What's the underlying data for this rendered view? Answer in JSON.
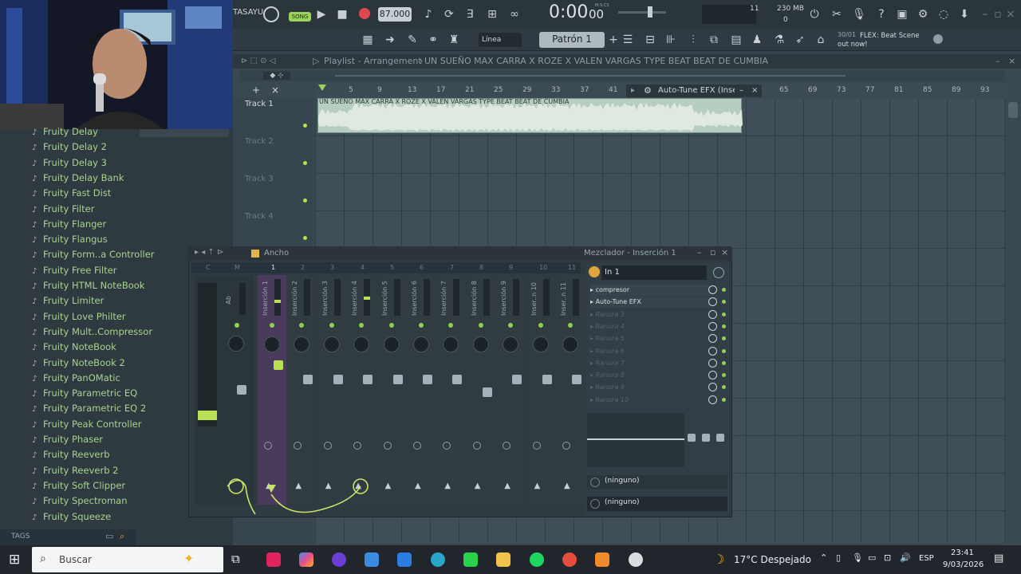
{
  "topbar": {
    "label_left": "TASAYU",
    "song_label": "SONG",
    "tempo": "87.000",
    "time_main": "0:00",
    "time_sub": "00",
    "time_unit": "M:S:CS",
    "cpu_value": "11",
    "mem_value": "230 MB",
    "mem_sub": "0"
  },
  "toolbar2": {
    "snap": "Línea",
    "pattern": "Patrón 1",
    "news_counter": "30/01",
    "news_text": "FLEX: Beat Scene out now!"
  },
  "playlist": {
    "title": "Playlist - Arrangement",
    "arrangement": "UN SUEÑO MAX CARRA X ROZE X VALEN VARGAS TYPE BEAT  BEAT DE CUMBIA",
    "ruler_ticks": [
      "5",
      "9",
      "13",
      "17",
      "21",
      "25",
      "29",
      "33",
      "37",
      "41",
      "65",
      "69",
      "73",
      "77",
      "81",
      "85",
      "89",
      "93"
    ],
    "tracks": [
      "Track 1",
      "Track 2",
      "Track 3",
      "Track 4"
    ],
    "clip_label": "UN SUEÑO MAX CARRA X ROZE X VALEN VARGAS TYPE BEAT  BEAT DE CUMBIA"
  },
  "autotune": {
    "title": "Auto-Tune EFX (Inser..."
  },
  "browser": {
    "items": [
      "Fruity Delay",
      "Fruity Delay 2",
      "Fruity Delay 3",
      "Fruity Delay Bank",
      "Fruity Fast Dist",
      "Fruity Filter",
      "Fruity Flanger",
      "Fruity Flangus",
      "Fruity Form..a Controller",
      "Fruity Free Filter",
      "Fruity HTML NoteBook",
      "Fruity Limiter",
      "Fruity Love Philter",
      "Fruity Mult..Compressor",
      "Fruity NoteBook",
      "Fruity NoteBook 2",
      "Fruity PanOMatic",
      "Fruity Parametric EQ",
      "Fruity Parametric EQ 2",
      "Fruity Peak Controller",
      "Fruity Phaser",
      "Fruity Reeverb",
      "Fruity Reeverb 2",
      "Fruity Soft Clipper",
      "Fruity Spectroman",
      "Fruity Squeeze"
    ],
    "tags_label": "TAGS"
  },
  "mixer": {
    "title_left": "Ancho",
    "title_right": "Mezclador - Inserción 1",
    "col_labels": [
      "C",
      "M",
      "1",
      "2",
      "3",
      "4",
      "5",
      "6",
      "7",
      "8",
      "9",
      "10",
      "11"
    ],
    "strips": [
      "Inserción 1",
      "Inserción 2",
      "Inserción 3",
      "Inserción 4",
      "Inserción 5",
      "Inserción 6",
      "Inserción 7",
      "Inserción 8",
      "Inserción 9",
      "Inser..n 10",
      "Inser..n 11"
    ],
    "master_label": "Ab",
    "input": "In 1",
    "slots": [
      "compresor",
      "Auto-Tune EFX",
      "Ranura 3",
      "Ranura 4",
      "Ranura 5",
      "Ranura 6",
      "Ranura 7",
      "Ranura 8",
      "Ranura 9",
      "Ranura 10"
    ],
    "out1": "(ninguno)",
    "out2": "(ninguno)"
  },
  "taskbar": {
    "search_placeholder": "Buscar",
    "weather": "17°C  Despejado",
    "lang": "ESP",
    "time": "23:41",
    "date": "9/03/2026"
  }
}
